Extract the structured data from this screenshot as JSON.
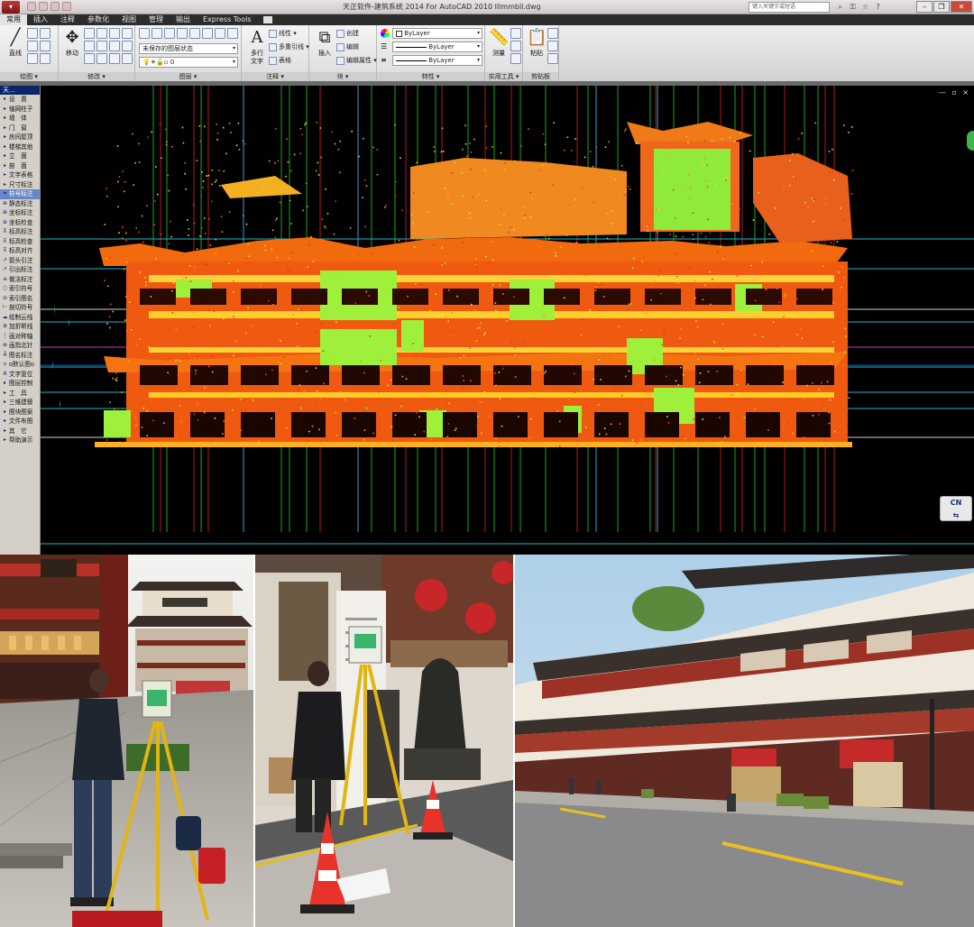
{
  "window": {
    "title": "天正软件-建筑系统 2014  For AutoCAD 2010   lllmmbll.dwg",
    "search_placeholder": "键入关键字或短语"
  },
  "ribbon_tabs": [
    "常用",
    "插入",
    "注释",
    "参数化",
    "视图",
    "管理",
    "输出",
    "Express Tools"
  ],
  "ribbon": {
    "draw": {
      "line_label": "直线",
      "panel_label": "绘图 ▾"
    },
    "modify": {
      "move_label": "移动",
      "panel_label": "修改 ▾"
    },
    "layers": {
      "state_combo": "未保存的图层状态",
      "layer_combo": "0",
      "panel_label": "图层 ▾"
    },
    "annotation": {
      "mtext_label": "多行\n文字",
      "linear_label": "线性",
      "multileader_label": "多重引线",
      "table_label": "表格",
      "panel_label": "注释 ▾"
    },
    "block": {
      "insert_label": "插入",
      "create_label": "创建",
      "edit_label": "编辑",
      "edit_attr_label": "编辑属性",
      "panel_label": "块 ▾"
    },
    "properties": {
      "color": "ByLayer",
      "linetype": "ByLayer",
      "lineweight": "ByLayer",
      "panel_label": "特性 ▾"
    },
    "utilities": {
      "measure_label": "测量",
      "panel_label": "实用工具 ▾"
    },
    "clipboard": {
      "paste_label": "粘贴",
      "panel_label": "剪贴板"
    }
  },
  "palette": {
    "header": "天...",
    "items": [
      {
        "label": "设　置",
        "mark": "▸"
      },
      {
        "label": "轴网柱子",
        "mark": "▸"
      },
      {
        "label": "墙　体",
        "mark": "▸"
      },
      {
        "label": "门　窗",
        "mark": "▸"
      },
      {
        "label": "房间屋顶",
        "mark": "▸"
      },
      {
        "label": "楼梯其他",
        "mark": "▸"
      },
      {
        "label": "立　面",
        "mark": "▸"
      },
      {
        "label": "剖　面",
        "mark": "▸"
      },
      {
        "label": "文字表格",
        "mark": "▸"
      },
      {
        "label": "尺寸标注",
        "mark": "▸"
      },
      {
        "label": "符号标注",
        "mark": "▾",
        "selected": true
      },
      {
        "label": "静态标注",
        "mark": "⊕"
      },
      {
        "label": "坐标标注",
        "mark": "⊕"
      },
      {
        "label": "坐标检查",
        "mark": "⊕"
      },
      {
        "label": "标高标注",
        "mark": "⊼"
      },
      {
        "label": "标高检查",
        "mark": "⊼"
      },
      {
        "label": "标高对齐",
        "mark": "⊼"
      },
      {
        "label": "箭头引注",
        "mark": "↗"
      },
      {
        "label": "引出标注",
        "mark": "↗"
      },
      {
        "label": "做法标注",
        "mark": "≡"
      },
      {
        "label": "索引符号",
        "mark": "○"
      },
      {
        "label": "索引图名",
        "mark": "⊖"
      },
      {
        "label": "剖切符号",
        "mark": "⊢"
      },
      {
        "label": "绘制云线",
        "mark": "☁"
      },
      {
        "label": "加折断线",
        "mark": "≷"
      },
      {
        "label": "画对称轴",
        "mark": "┆"
      },
      {
        "label": "画指北针",
        "mark": "⊕"
      },
      {
        "label": "图名标注",
        "mark": "Ā"
      },
      {
        "label": "o默认图o",
        "mark": "▫"
      },
      {
        "label": "文字复位",
        "mark": "A"
      },
      {
        "label": "图层控制",
        "mark": "▸"
      },
      {
        "label": "工　具",
        "mark": "▸"
      },
      {
        "label": "三维建模",
        "mark": "▸"
      },
      {
        "label": "图块图案",
        "mark": "▸"
      },
      {
        "label": "文件布图",
        "mark": "▸"
      },
      {
        "label": "其　它",
        "mark": "▸"
      },
      {
        "label": "帮助演示",
        "mark": "▸"
      }
    ]
  },
  "drawing": {
    "viewport_controls": "— ▫ ×",
    "nav_label": "CN"
  },
  "photos": [
    {
      "alt": "surveyor with laser scanner on yellow tripod in plaza"
    },
    {
      "alt": "surveyor beside scanner and traffic cones under arcade"
    },
    {
      "alt": "traditional Chinese building facade along street"
    }
  ]
}
